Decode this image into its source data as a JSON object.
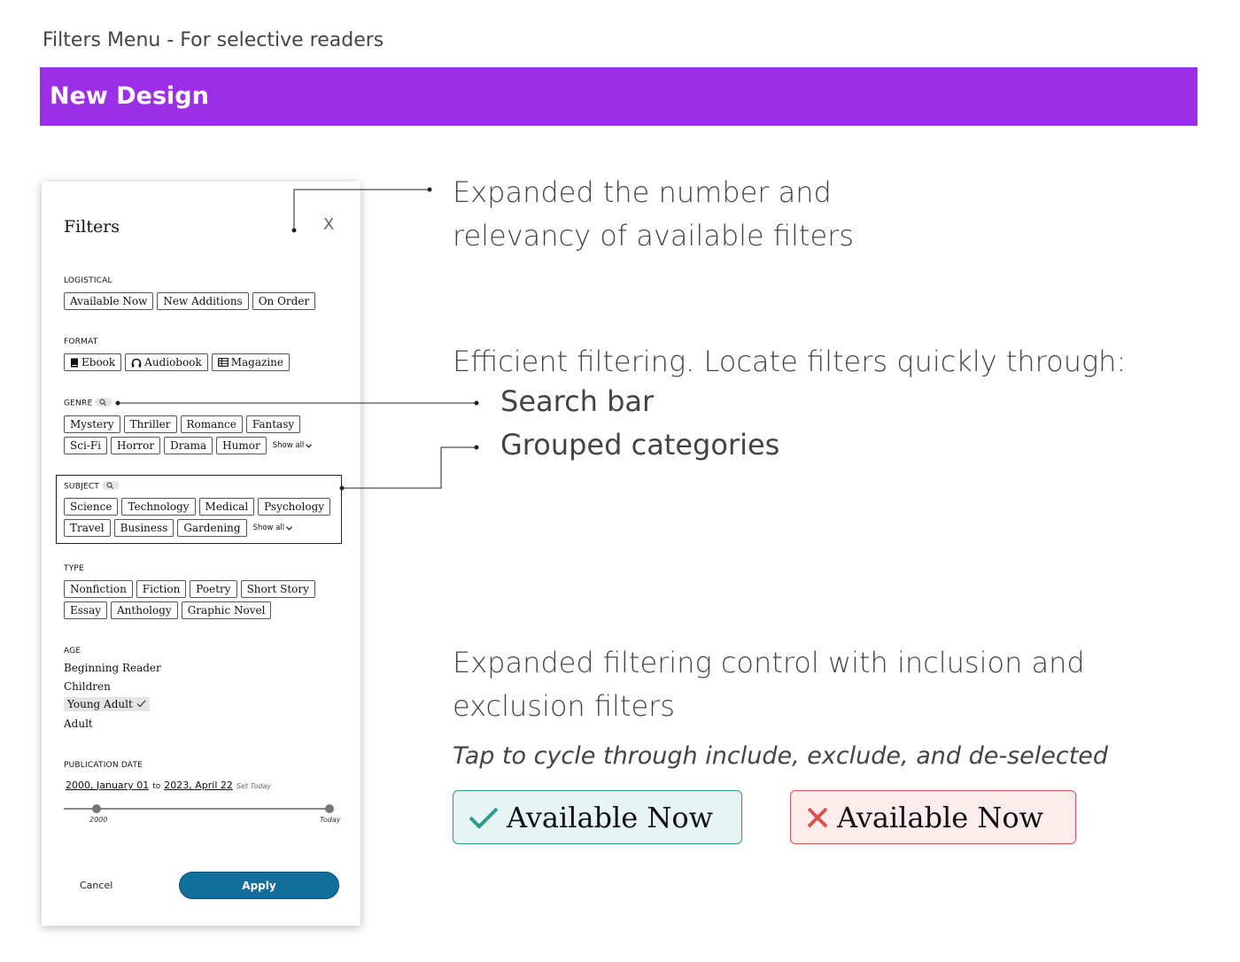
{
  "page_title": "Filters Menu - For selective readers",
  "banner": "New Design",
  "panel": {
    "title": "Filters",
    "close": "X",
    "logistical": {
      "label": "LOGISTICAL",
      "chips": [
        "Available Now",
        "New Additions",
        "On Order"
      ]
    },
    "format": {
      "label": "FORMAT",
      "chips": [
        "Ebook",
        "Audiobook",
        "Magazine"
      ]
    },
    "genre": {
      "label": "GENRE",
      "row1": [
        "Mystery",
        "Thriller",
        "Romance",
        "Fantasy"
      ],
      "row2": [
        "Sci-Fi",
        "Horror",
        "Drama",
        "Humor"
      ],
      "show_all": "Show all"
    },
    "subject": {
      "label": "SUBJECT",
      "row1": [
        "Science",
        "Technology",
        "Medical",
        "Psychology"
      ],
      "row2": [
        "Travel",
        "Business",
        "Gardening"
      ],
      "show_all": "Show all"
    },
    "type": {
      "label": "TYPE",
      "row1": [
        "Nonfiction",
        "Fiction",
        "Poetry",
        "Short Story"
      ],
      "row2": [
        "Essay",
        "Anthology",
        "Graphic Novel"
      ]
    },
    "age": {
      "label": "AGE",
      "items": [
        "Beginning Reader",
        "Children",
        "Young Adult",
        "Adult"
      ],
      "selected": "Young Adult"
    },
    "publication_date": {
      "label": "PUBLICATION DATE",
      "from_year": "2000",
      "from_month": "January",
      "from_day": "01",
      "to": "to",
      "to_year": "2023",
      "to_month": "April",
      "to_day": "22",
      "set_today": "Set Today",
      "slider_min_label": "2000",
      "slider_max_label": "Today"
    },
    "cancel": "Cancel",
    "apply": "Apply"
  },
  "annotations": {
    "a1_line1": "Expanded the number and",
    "a1_line2": "relevancy of available filters",
    "a2_line": "Efficient filtering. Locate filters quickly through:",
    "a2_bullet1": "Search bar",
    "a2_bullet2": "Grouped categories",
    "a3_line1": "Expanded filtering control with inclusion and",
    "a3_line2": "exclusion filters",
    "a4": "Tap to cycle through include, exclude, and de-selected",
    "include_chip": "Available Now",
    "exclude_chip": "Available Now"
  },
  "colors": {
    "banner": "#9b2ee6",
    "apply_button": "#126f9b",
    "include_check": "#2c9a92",
    "exclude_x": "#d9534f"
  }
}
